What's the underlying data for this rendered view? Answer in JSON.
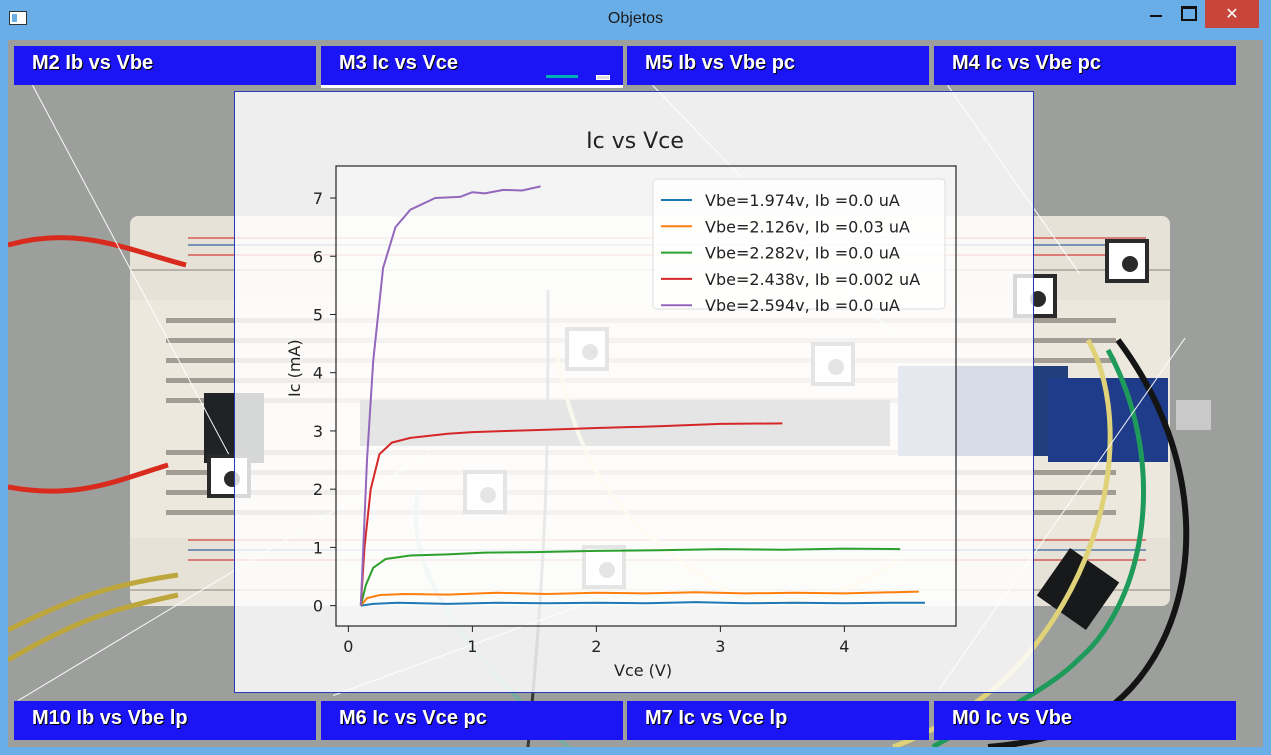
{
  "window": {
    "title": "Objetos",
    "controls": {
      "minimize_icon": "minimize-icon",
      "maximize_icon": "maximize-icon",
      "close_icon": "close-icon",
      "close_label": "✕"
    }
  },
  "panels": {
    "top": [
      {
        "label": "M2  Ib vs Vbe"
      },
      {
        "label": "M3  Ic vs Vce"
      },
      {
        "label": "M5  Ib vs Vbe pc"
      },
      {
        "label": "M4  Ic vs Vbe pc"
      }
    ],
    "bottom": [
      {
        "label": "M10  Ib vs Vbe lp"
      },
      {
        "label": "M6  Ic vs Vce pc"
      },
      {
        "label": "M7  Ic vs Vce lp"
      },
      {
        "label": "M0  Ic vs Vbe"
      }
    ]
  },
  "colors": {
    "panel_blue": "#1b14f4",
    "window_blue": "#6aaee8",
    "close_red": "#c7453b"
  },
  "chart_data": {
    "type": "line",
    "title": "Ic vs Vce",
    "xlabel": "Vce (V)",
    "ylabel": "Ic (mA)",
    "xlim": [
      -0.1,
      4.9
    ],
    "ylim": [
      -0.35,
      7.55
    ],
    "xticks": [
      0,
      1,
      2,
      3,
      4
    ],
    "yticks": [
      0,
      1,
      2,
      3,
      4,
      5,
      6,
      7
    ],
    "legend": "top-right",
    "series": [
      {
        "name": "Vbe=1.974v, Ib =0.0 uA",
        "color": "#1f77b4",
        "points": [
          [
            0.1,
            0.0
          ],
          [
            0.2,
            0.03
          ],
          [
            0.4,
            0.05
          ],
          [
            0.8,
            0.03
          ],
          [
            1.2,
            0.05
          ],
          [
            1.6,
            0.04
          ],
          [
            2.0,
            0.05
          ],
          [
            2.4,
            0.04
          ],
          [
            2.8,
            0.06
          ],
          [
            3.2,
            0.04
          ],
          [
            3.6,
            0.05
          ],
          [
            4.0,
            0.04
          ],
          [
            4.4,
            0.05
          ],
          [
            4.65,
            0.05
          ]
        ]
      },
      {
        "name": "Vbe=2.126v, Ib =0.03 uA",
        "color": "#ff7f0e",
        "points": [
          [
            0.1,
            0.0
          ],
          [
            0.15,
            0.13
          ],
          [
            0.25,
            0.18
          ],
          [
            0.45,
            0.2
          ],
          [
            0.8,
            0.19
          ],
          [
            1.2,
            0.22
          ],
          [
            1.6,
            0.2
          ],
          [
            2.0,
            0.22
          ],
          [
            2.4,
            0.21
          ],
          [
            2.8,
            0.23
          ],
          [
            3.2,
            0.21
          ],
          [
            3.6,
            0.22
          ],
          [
            4.0,
            0.21
          ],
          [
            4.4,
            0.23
          ],
          [
            4.6,
            0.24
          ]
        ]
      },
      {
        "name": "Vbe=2.282v, Ib =0.0 uA",
        "color": "#2ca02c",
        "points": [
          [
            0.1,
            0.0
          ],
          [
            0.14,
            0.35
          ],
          [
            0.2,
            0.65
          ],
          [
            0.3,
            0.8
          ],
          [
            0.5,
            0.86
          ],
          [
            0.8,
            0.88
          ],
          [
            1.1,
            0.91
          ],
          [
            1.5,
            0.92
          ],
          [
            2.0,
            0.94
          ],
          [
            2.5,
            0.95
          ],
          [
            3.0,
            0.97
          ],
          [
            3.5,
            0.96
          ],
          [
            4.0,
            0.98
          ],
          [
            4.45,
            0.97
          ]
        ]
      },
      {
        "name": "Vbe=2.438v, Ib =0.002 uA",
        "color": "#d62728",
        "points": [
          [
            0.1,
            0.0
          ],
          [
            0.13,
            1.0
          ],
          [
            0.18,
            2.0
          ],
          [
            0.25,
            2.6
          ],
          [
            0.35,
            2.8
          ],
          [
            0.5,
            2.88
          ],
          [
            0.8,
            2.95
          ],
          [
            1.0,
            2.98
          ],
          [
            1.3,
            3.0
          ],
          [
            1.6,
            3.02
          ],
          [
            2.0,
            3.05
          ],
          [
            2.5,
            3.08
          ],
          [
            3.0,
            3.12
          ],
          [
            3.5,
            3.13
          ]
        ]
      },
      {
        "name": "Vbe=2.594v, Ib =0.0 uA",
        "color": "#9467bd",
        "points": [
          [
            0.1,
            0.0
          ],
          [
            0.12,
            1.0
          ],
          [
            0.15,
            2.5
          ],
          [
            0.2,
            4.2
          ],
          [
            0.28,
            5.8
          ],
          [
            0.38,
            6.5
          ],
          [
            0.5,
            6.8
          ],
          [
            0.7,
            7.0
          ],
          [
            0.9,
            7.02
          ],
          [
            1.0,
            7.1
          ],
          [
            1.1,
            7.08
          ],
          [
            1.25,
            7.14
          ],
          [
            1.4,
            7.13
          ],
          [
            1.55,
            7.2
          ]
        ]
      }
    ]
  },
  "markers": {
    "icons": [
      "fiducial-marker-icon",
      "fiducial-marker-icon",
      "fiducial-marker-icon",
      "fiducial-marker-icon",
      "fiducial-marker-icon",
      "fiducial-marker-icon",
      "smiley-marker-icon"
    ]
  }
}
